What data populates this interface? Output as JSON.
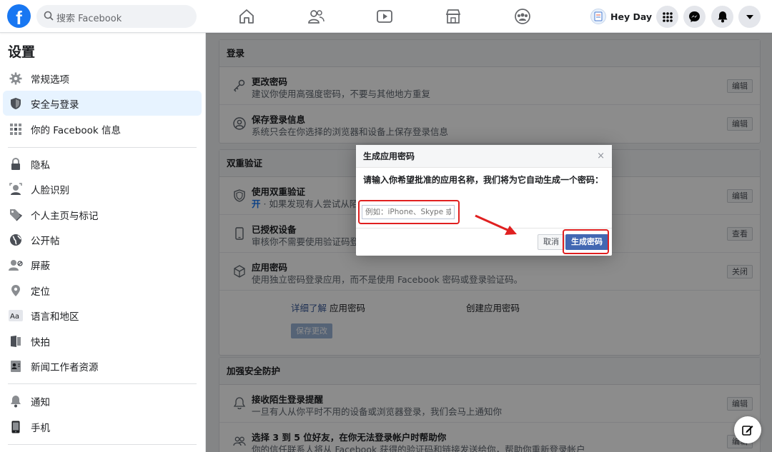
{
  "header": {
    "logo_letter": "f",
    "search_placeholder": "搜索 Facebook",
    "user_name": "Hey Day"
  },
  "sidebar": {
    "title": "设置",
    "items": [
      {
        "label": "常规选项",
        "icon": "gear-icon"
      },
      {
        "label": "安全与登录",
        "icon": "shield-icon",
        "active": true
      },
      {
        "label": "你的 Facebook 信息",
        "icon": "grid-icon"
      },
      {
        "label": "隐私",
        "icon": "lock-icon"
      },
      {
        "label": "人脸识别",
        "icon": "face-icon"
      },
      {
        "label": "个人主页与标记",
        "icon": "tag-icon"
      },
      {
        "label": "公开帖",
        "icon": "globe-icon"
      },
      {
        "label": "屏蔽",
        "icon": "block-user-icon"
      },
      {
        "label": "定位",
        "icon": "location-icon"
      },
      {
        "label": "语言和地区",
        "icon": "language-icon"
      },
      {
        "label": "快拍",
        "icon": "story-icon"
      },
      {
        "label": "新闻工作者资源",
        "icon": "news-icon"
      },
      {
        "label": "通知",
        "icon": "bell-icon"
      },
      {
        "label": "手机",
        "icon": "phone-icon"
      }
    ]
  },
  "login": {
    "header": "登录",
    "rows": [
      {
        "title": "更改密码",
        "desc": "建议你使用高强度密码，不要与其他地方重复",
        "button": "编辑"
      },
      {
        "title": "保存登录信息",
        "desc": "系统只会在你选择的浏览器和设备上保存登录信息",
        "button": "编辑"
      }
    ]
  },
  "twofa": {
    "header": "双重验证",
    "rows": [
      {
        "title": "使用双重验证",
        "desc_on": "开",
        "desc": " · 如果发现有人尝试从陌",
        "button": "编辑"
      },
      {
        "title": "已授权设备",
        "desc": "审核你不需要使用验证码登",
        "button": "查看"
      },
      {
        "title": "应用密码",
        "desc": "使用独立密码登录应用，而不是使用 Facebook 密码或登录验证码。",
        "button": "关闭"
      }
    ],
    "learn_more": "详细了解",
    "app_password_label": "应用密码",
    "create_label": "创建应用密码",
    "save_button": "保存更改"
  },
  "security": {
    "header": "加强安全防护",
    "rows": [
      {
        "title": "接收陌生登录提醒",
        "desc": "一旦有人从你平时不用的设备或浏览器登录，我们会马上通知你",
        "button": "编辑"
      },
      {
        "title": "选择 3 到 5 位好友，在你无法登录帐户时帮助你",
        "desc": "你的信任联系人将从 Facebook 获得的验证码和链接发送给你，帮助你重新登录帐户",
        "button": "编辑"
      }
    ]
  },
  "dialog": {
    "title": "生成应用密码",
    "close": "×",
    "message": "请输入你希望批准的应用名称，我们将为它自动生成一个密码：",
    "input_placeholder": "例如：iPhone、Skype 或",
    "cancel": "取消",
    "generate": "生成密码"
  },
  "colors": {
    "brand": "#1877f2",
    "primary_button": "#4267b2",
    "highlight": "#e02020"
  }
}
